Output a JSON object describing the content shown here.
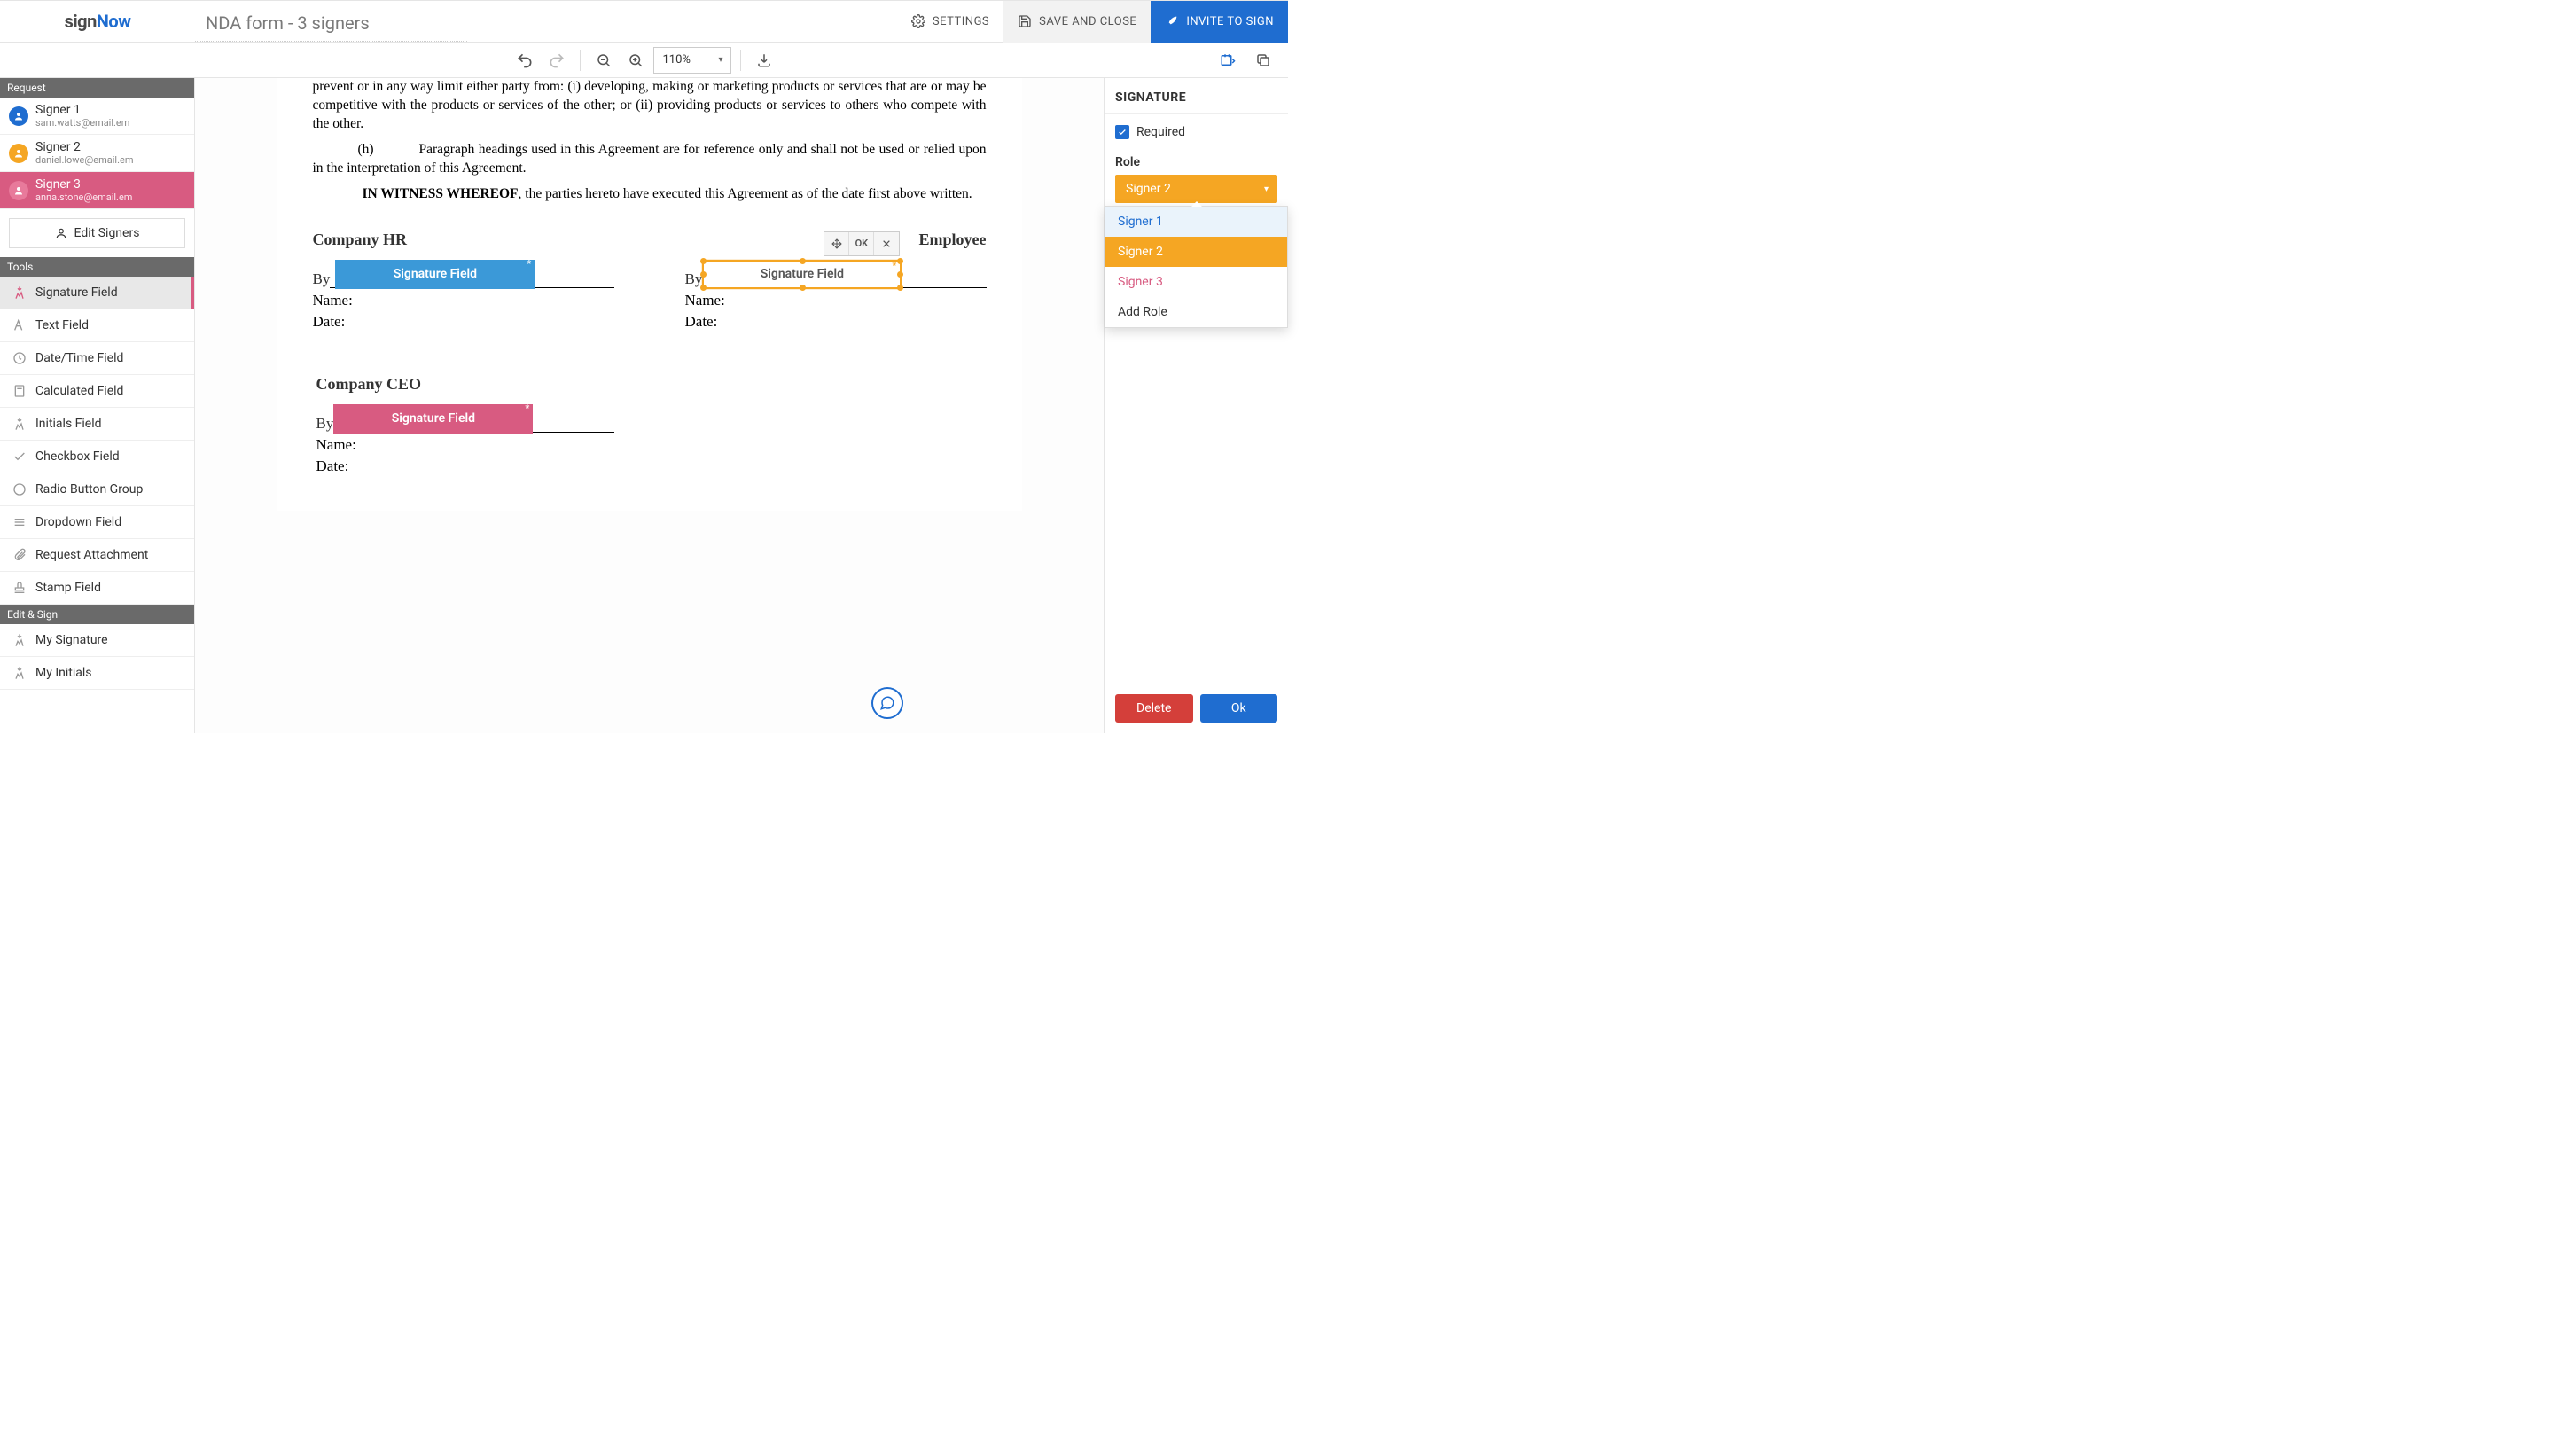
{
  "brand": {
    "sign": "sign",
    "now": "Now"
  },
  "header": {
    "doc_title": "NDA form - 3 signers",
    "settings": "SETTINGS",
    "save_close": "SAVE AND CLOSE",
    "invite": "INVITE TO SIGN"
  },
  "toolbar": {
    "zoom": "110%"
  },
  "sidebar": {
    "section_request": "Request",
    "section_tools": "Tools",
    "section_editsign": "Edit & Sign",
    "edit_signers": "Edit Signers",
    "signers": [
      {
        "name": "Signer 1",
        "email": "sam.watts@email.em"
      },
      {
        "name": "Signer 2",
        "email": "daniel.lowe@email.em"
      },
      {
        "name": "Signer 3",
        "email": "anna.stone@email.em"
      }
    ],
    "tools": {
      "signature": "Signature Field",
      "text": "Text Field",
      "datetime": "Date/Time Field",
      "calculated": "Calculated Field",
      "initials": "Initials Field",
      "checkbox": "Checkbox Field",
      "radio": "Radio Button Group",
      "dropdown": "Dropdown Field",
      "attachment": "Request Attachment",
      "stamp": "Stamp Field",
      "mysignature": "My Signature",
      "myinitials": "My Initials"
    }
  },
  "doc": {
    "p1": "prevent or in any way limit either party from: (i) developing, making or marketing products or services that are or may be competitive with the products or services of the other; or (ii) providing products or services to others who compete with the other.",
    "p2_clause": "(h)",
    "p2": "Paragraph headings used in this Agreement are for reference only and shall not be used or relied upon in the interpretation of this Agreement.",
    "p3_bold": "IN WITNESS WHEREOF",
    "p3_rest": ", the parties hereto have executed this Agreement as of the date first above written.",
    "company_hr": "Company HR",
    "employee": "Employee",
    "company_ceo": "Company CEO",
    "by": "By",
    "name": "Name:",
    "date": "Date:",
    "sig_label": "Signature Field",
    "field_toolbar_ok": "OK"
  },
  "rightpanel": {
    "title": "SIGNATURE",
    "required": "Required",
    "role_label": "Role",
    "role_selected": "Signer 2",
    "options": {
      "s1": "Signer 1",
      "s2": "Signer 2",
      "s3": "Signer 3",
      "add": "Add Role"
    },
    "delete": "Delete",
    "ok": "Ok"
  }
}
